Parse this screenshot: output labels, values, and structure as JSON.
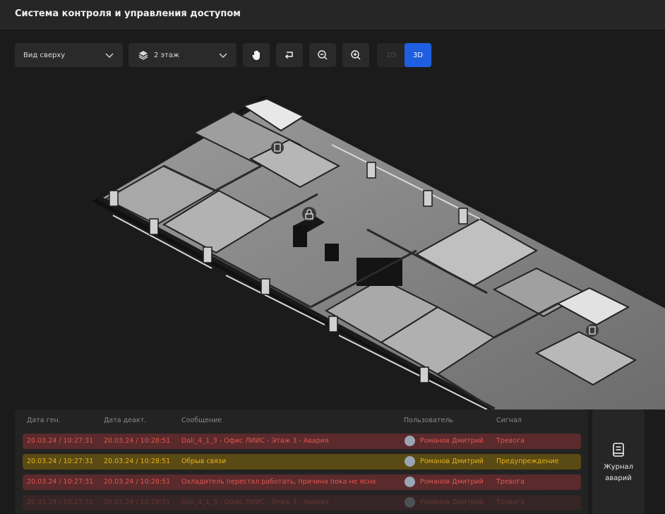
{
  "app": {
    "title": "Система контроля и управления доступом"
  },
  "toolbar": {
    "view_select": {
      "value": "Вид сверху",
      "icon": "chevron-down-icon"
    },
    "floor_select": {
      "value": "2 этаж",
      "icon": "layers-icon"
    },
    "tools": [
      {
        "name": "hand-icon"
      },
      {
        "name": "return-icon"
      },
      {
        "name": "zoom-out-icon"
      },
      {
        "name": "zoom-in-icon"
      }
    ],
    "mode": {
      "options": [
        "2D",
        "3D"
      ],
      "selected": "3D"
    }
  },
  "colors": {
    "accent": "#1f5ee0",
    "alarm_bg": "#5a2a2c",
    "alarm_text": "#e0574f",
    "warning_bg": "#5a4a13",
    "warning_text": "#e6b21d"
  },
  "events_table": {
    "headers": [
      "Дата ген.",
      "Дата деакт.",
      "Сообщение",
      "Пользователь",
      "Сигнал"
    ],
    "rows": [
      {
        "gen": "20.03.24 / 10:27:31",
        "deact": "20.03.24 / 10:28:51",
        "message": "Dali_4_1_3 - Офис ЛИИС - Этаж 3 - Авария",
        "user": "Романов Дмитрий",
        "signal": "Тревога",
        "level": "alarm"
      },
      {
        "gen": "20.03.24 / 10:27:31",
        "deact": "20.03.24 / 10:28:51",
        "message": "Обрыв связи",
        "user": "Романов Дмитрий",
        "signal": "Предупреждение",
        "level": "warning"
      },
      {
        "gen": "20.03.24 / 10:27:31",
        "deact": "20.03.24 / 10:28:51",
        "message": "Охладитель перестал работать, причина пока не ясна",
        "user": "Романов Дмитрий",
        "signal": "Тревога",
        "level": "alarm"
      },
      {
        "gen": "20.03.24 / 10:27:31",
        "deact": "20.03.24 / 10:28:51",
        "message": "Dali_4_1_3 - Офис ЛИИС - Этаж 3 - Авария",
        "user": "Романов Дмитрий",
        "signal": "Тревога",
        "level": "alarm"
      }
    ]
  },
  "journal": {
    "label_line1": "Журнал",
    "label_line2": "аварий",
    "icon": "journal-icon"
  }
}
